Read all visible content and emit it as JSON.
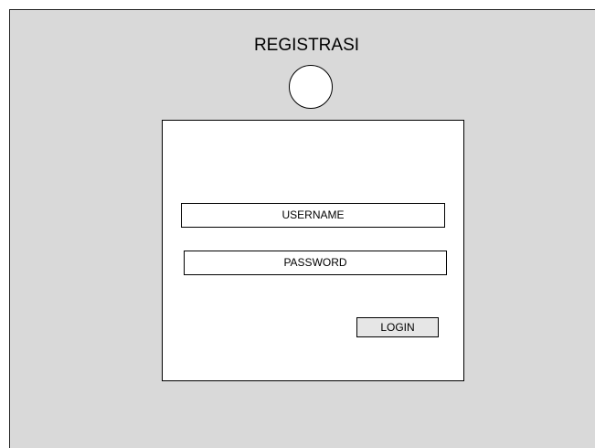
{
  "page": {
    "title": "REGISTRASI",
    "background_color": "#d9d9d9",
    "logo_icon": "circle-placeholder-icon"
  },
  "form": {
    "username_placeholder": "USERNAME",
    "password_placeholder": "PASSWORD",
    "login_label": "LOGIN"
  }
}
